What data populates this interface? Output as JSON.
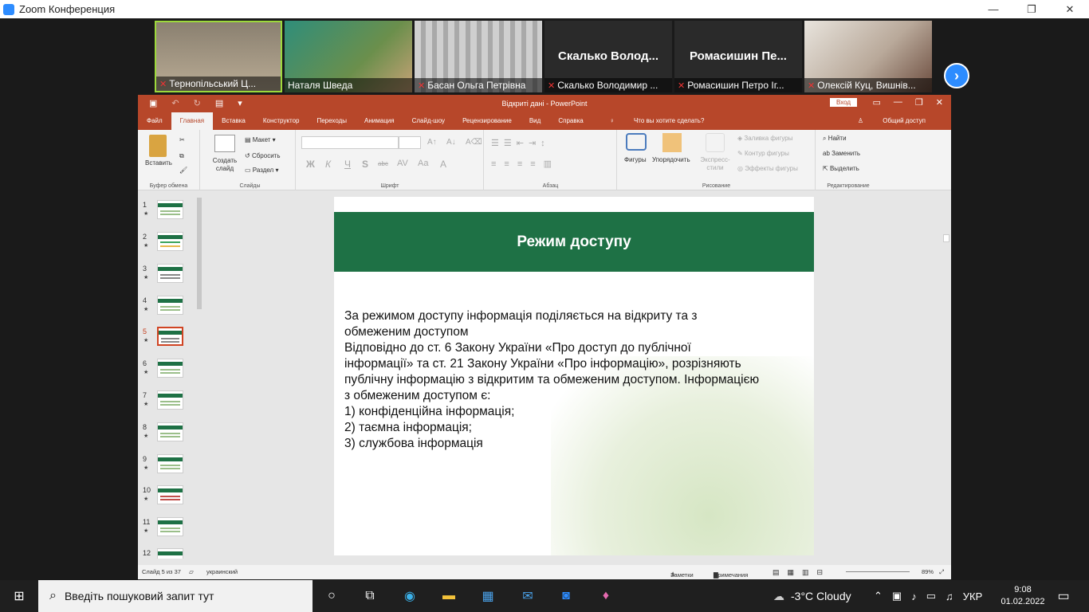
{
  "window": {
    "title": "Zoom Конференция",
    "minimize": "—",
    "restore": "❐",
    "close": "✕"
  },
  "participants": [
    {
      "caption": "Тернопільський Ц...",
      "big": ""
    },
    {
      "caption": "Наталя Шведа",
      "big": ""
    },
    {
      "caption": "Басан Ольга Петрівна",
      "big": ""
    },
    {
      "caption": "Скалько Володимир ...",
      "big": "Скалько  Волод..."
    },
    {
      "caption": "Ромасишин Петро Іг...",
      "big": "Ромасишин  Пе..."
    },
    {
      "caption": "Олексій Куц, Вишнів...",
      "big": ""
    }
  ],
  "ppt": {
    "doc_title": "Відкриті дані  -  PowerPoint",
    "login": "Вход",
    "tabs": [
      "Файл",
      "Главная",
      "Вставка",
      "Конструктор",
      "Переходы",
      "Анимация",
      "Слайд-шоу",
      "Рецензирование",
      "Вид",
      "Справка",
      "Что вы хотите сделать?"
    ],
    "share": "Общий доступ",
    "ribbon": {
      "paste": "Вставить",
      "clipboard": "Буфер обмена",
      "new_slide": "Создать слайд",
      "layout": "Макет",
      "reset": "Сбросить",
      "section": "Раздел",
      "slides": "Слайды",
      "font": "Шрифт",
      "paragraph": "Абзац",
      "shapes": "Фигуры",
      "arrange": "Упорядочить",
      "styles": "Экспресс-стили",
      "fill": "Заливка фигуры",
      "outline": "Контур фигуры",
      "effects": "Эффекты фигуры",
      "drawing": "Рисование",
      "find": "Найти",
      "replace": "Заменить",
      "select": "Выделить",
      "editing": "Редактирование",
      "font_btns": [
        "Ж",
        "К",
        "Ч",
        "S",
        "abc",
        "AV",
        "Aa",
        "A"
      ]
    },
    "thumbs": [
      "1",
      "2",
      "3",
      "4",
      "5",
      "6",
      "7",
      "8",
      "9",
      "10",
      "11",
      "12"
    ],
    "selected_slide": 5,
    "slide": {
      "title": "Режим доступу",
      "lines": [
        "За режимом доступу інформація поділяється на відкриту та з",
        "обмеженим доступом",
        "Відповідно до ст. 6 Закону України «Про доступ до публічної",
        "інформації» та ст. 21 Закону України «Про інформацію», розрізняють",
        "публічну інформацію з відкритим та обмеженим доступом. Інформацією",
        "з обмеженим доступом є:",
        "1) конфіденційна інформація;",
        "2) таємна інформація;",
        "3) службова інформація"
      ]
    },
    "status": {
      "slide": "Слайд 5 из 37",
      "lang": "украинский",
      "notes": "Заметки",
      "comments": "Примечания",
      "zoom": "89%"
    }
  },
  "taskbar": {
    "search": "Введіть пошуковий запит тут",
    "weather": "-3°C  Cloudy",
    "lang": "УКР",
    "time": "9:08",
    "date": "01.02.2022"
  }
}
